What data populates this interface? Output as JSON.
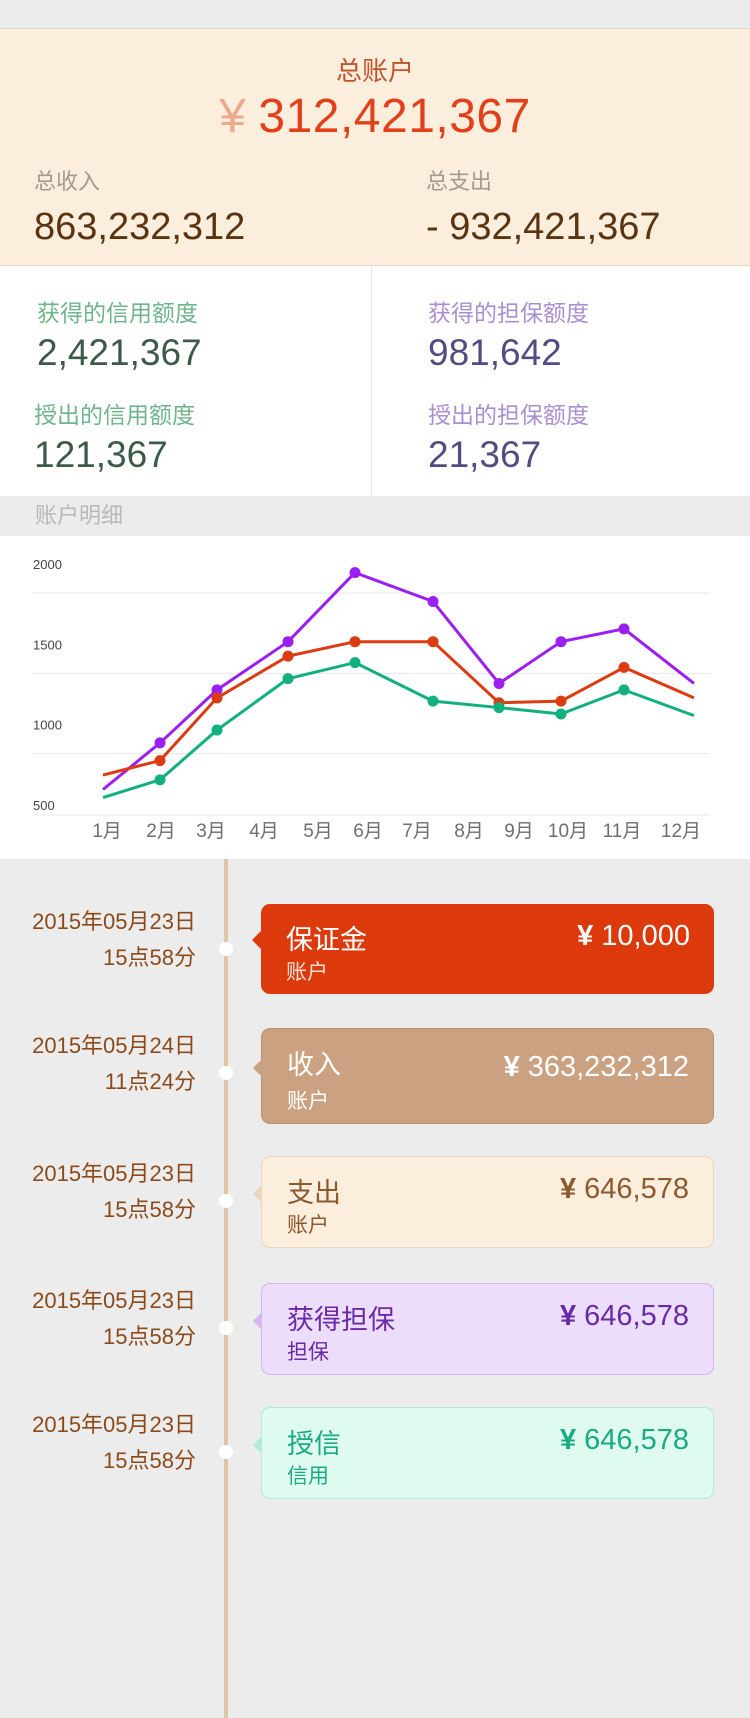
{
  "summary": {
    "title": "总账户",
    "currency": "¥",
    "total": "312,421,367",
    "income_label": "总收入",
    "income_value": "863,232,312",
    "expense_label": "总支出",
    "expense_value": "- 932,421,367"
  },
  "credit": {
    "received_credit_label": "获得的信用额度",
    "received_credit_value": "2,421,367",
    "granted_credit_label": "授出的信用额度",
    "granted_credit_value": "121,367",
    "received_guarantee_label": "获得的担保额度",
    "received_guarantee_value": "981,642",
    "granted_guarantee_label": "授出的担保额度",
    "granted_guarantee_value": "21,367"
  },
  "detail_label": "账户明细",
  "chart_data": {
    "type": "line",
    "categories": [
      "1月",
      "2月",
      "3月",
      "4月",
      "5月",
      "6月",
      "7月",
      "8月",
      "9月",
      "10月",
      "11月",
      "12月"
    ],
    "ylim": [
      500,
      2000
    ],
    "yticks": [
      "2000",
      "1500",
      "1000",
      "500"
    ],
    "grid": true,
    "legend": "none",
    "series": [
      {
        "color": "#9b1ff0",
        "values": [
          640,
          930,
          1260,
          1560,
          1990,
          1810,
          1300,
          1560,
          1640,
          1300
        ]
      },
      {
        "color": "#dd3b10",
        "values": [
          730,
          820,
          1210,
          1470,
          1560,
          1560,
          1180,
          1190,
          1400,
          1210
        ]
      },
      {
        "color": "#12b07f",
        "values": [
          590,
          700,
          1010,
          1330,
          1430,
          1190,
          1150,
          1110,
          1260,
          1100
        ]
      }
    ],
    "x_positions": [
      0,
      1,
      2,
      3,
      4,
      5,
      6,
      7,
      8,
      9
    ]
  },
  "timeline": [
    {
      "date": "2015年05月23日",
      "time": "15点58分",
      "title": "保证金",
      "sub": "账户",
      "currency": "¥",
      "amount": "10,000"
    },
    {
      "date": "2015年05月24日",
      "time": "11点24分",
      "title": "收入",
      "sub": "账户",
      "currency": "¥",
      "amount": "363,232,312"
    },
    {
      "date": "2015年05月23日",
      "time": "15点58分",
      "title": "支出",
      "sub": "账户",
      "currency": "¥",
      "amount": "646,578"
    },
    {
      "date": "2015年05月23日",
      "time": "15点58分",
      "title": "获得担保",
      "sub": "担保",
      "currency": "¥",
      "amount": "646,578"
    },
    {
      "date": "2015年05月23日",
      "time": "15点58分",
      "title": "授信",
      "sub": "信用",
      "currency": "¥",
      "amount": "646,578"
    }
  ],
  "colors": {
    "card_deposit_bg": "#dc3a0c",
    "card_income_bg": "#caa282",
    "card_expense_bg": "#fbeedd",
    "card_guarantee_bg": "#ecddfb",
    "card_credit_bg": "#dffbf0"
  }
}
